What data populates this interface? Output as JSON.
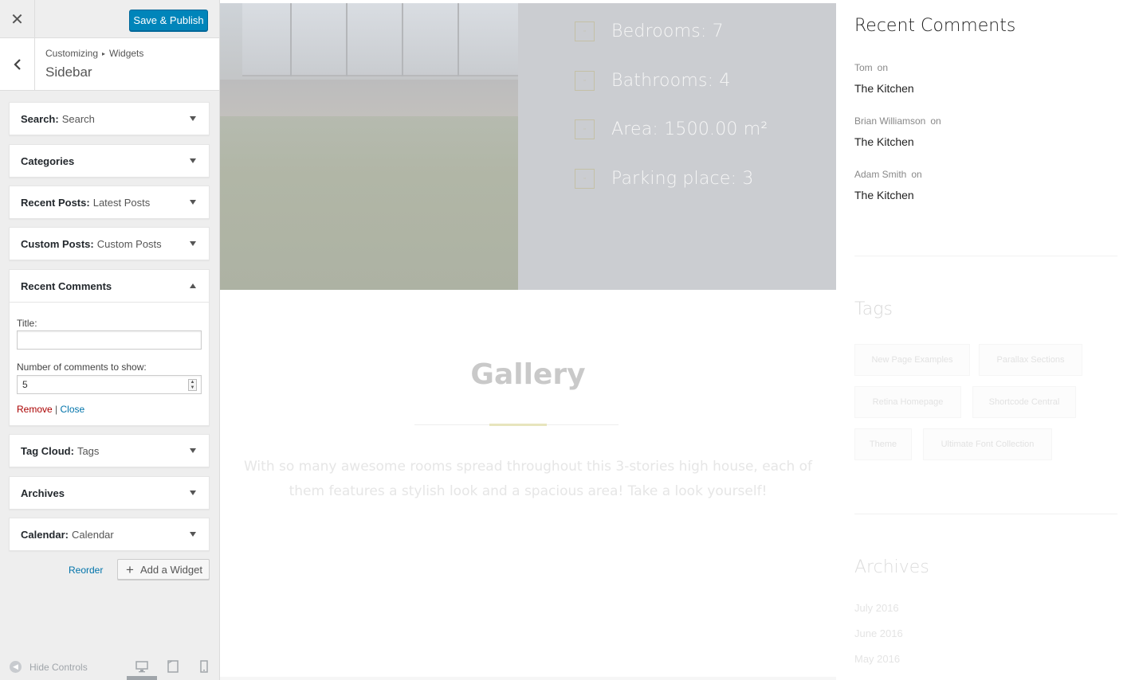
{
  "customizer": {
    "close_glyph": "✕",
    "save_label": "Save & Publish",
    "breadcrumb": {
      "root": "Customizing",
      "separator": "▸",
      "section": "Widgets"
    },
    "section_title": "Sidebar",
    "widgets": [
      {
        "title": "Search",
        "subtitle": "Search"
      },
      {
        "title": "Categories",
        "subtitle": ""
      },
      {
        "title": "Recent Posts",
        "subtitle": "Latest Posts"
      },
      {
        "title": "Custom Posts",
        "subtitle": "Custom Posts"
      },
      {
        "title": "Recent Comments",
        "subtitle": ""
      },
      {
        "title": "Tag Cloud",
        "subtitle": "Tags"
      },
      {
        "title": "Archives",
        "subtitle": ""
      },
      {
        "title": "Calendar",
        "subtitle": "Calendar"
      }
    ],
    "open_widget": {
      "title_label": "Title:",
      "title_value": "",
      "count_label": "Number of comments to show:",
      "count_value": "5",
      "remove_label": "Remove",
      "divider": "|",
      "close_label": "Close"
    },
    "reorder_label": "Reorder",
    "add_widget_label": "Add a Widget",
    "hide_controls_label": "Hide Controls"
  },
  "preview": {
    "features": [
      "Bedrooms: 7",
      "Bathrooms: 4",
      "Area: 1500.00 m²",
      "Parking place: 3"
    ],
    "gallery": {
      "title": "Gallery",
      "description": "With so many awesome rooms spread throughout this 3-stories high house, each of them features a stylish look and a spacious area! Take a look yourself!"
    },
    "recent_comments": {
      "title": "Recent Comments",
      "on_word": "on",
      "items": [
        {
          "author": "Tom",
          "post": "The Kitchen"
        },
        {
          "author": "Brian Williamson",
          "post": "The Kitchen"
        },
        {
          "author": "Adam Smith",
          "post": "The Kitchen"
        }
      ]
    },
    "tags": {
      "title": "Tags",
      "items": [
        "New Page Examples",
        "Parallax Sections",
        "Retina Homepage",
        "Shortcode Central",
        "Theme",
        "Ultimate Font Collection"
      ]
    },
    "archives": {
      "title": "Archives",
      "items": [
        "July 2016",
        "June 2016",
        "May 2016"
      ]
    }
  },
  "colors": {
    "publish_button": "#0085ba",
    "remove_link": "#aa0000",
    "link": "#0073aa",
    "hero_overlay": "#cbcdd1"
  }
}
